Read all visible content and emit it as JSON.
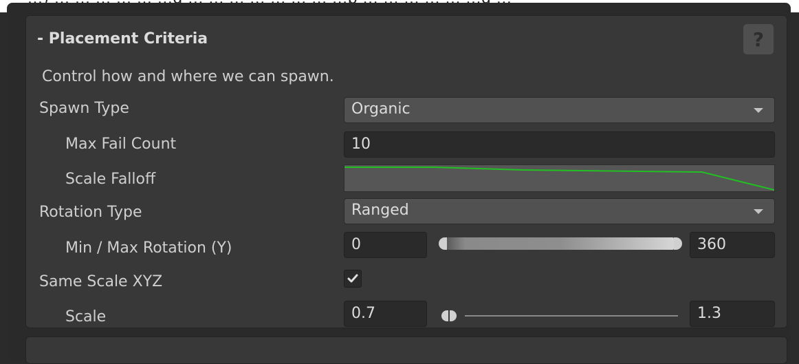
{
  "top_strip_text": "...) ... ... ... ... ... ...g ... ... ... ... ... ... ... ...p ... ... ... ... ... ...g ...",
  "section": {
    "title": "- Placement Criteria",
    "help_label": "?",
    "description": "Control how and where we can spawn."
  },
  "fields": {
    "spawn_type": {
      "label": "Spawn Type",
      "value": "Organic"
    },
    "max_fail_count": {
      "label": "Max Fail Count",
      "value": "10"
    },
    "scale_falloff": {
      "label": "Scale Falloff"
    },
    "rotation_type": {
      "label": "Rotation Type",
      "value": "Ranged"
    },
    "min_max_rotation": {
      "label": "Min / Max Rotation (Y)",
      "min": "0",
      "max": "360"
    },
    "same_scale_xyz": {
      "label": "Same Scale XYZ",
      "checked": true
    },
    "scale": {
      "label": "Scale",
      "min": "0.7",
      "max": "1.3"
    }
  },
  "colors": {
    "curve": "#22c022",
    "panel": "#383838",
    "field": "#2a2a2a"
  },
  "icons": {
    "dropdown": "chevron-down-icon",
    "check": "checkmark-icon",
    "help": "help-icon"
  }
}
